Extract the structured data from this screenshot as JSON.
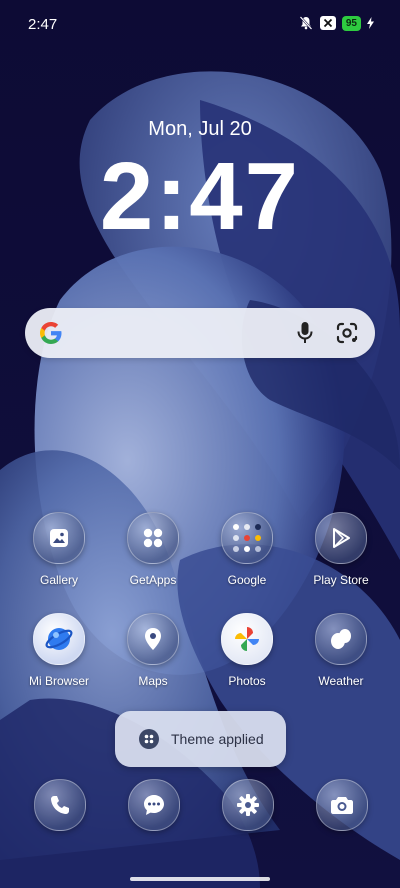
{
  "status_bar": {
    "time": "2:47",
    "battery_level": "95",
    "icons": [
      "silent-bell-icon",
      "x-notification-icon",
      "battery-icon",
      "charging-bolt-icon"
    ],
    "battery_color": "#2ecc40"
  },
  "lockscreen": {
    "date": "Mon, Jul 20",
    "clock": "2:47"
  },
  "search_bar": {
    "icons": [
      "google-logo-icon",
      "microphone-icon",
      "google-lens-icon"
    ]
  },
  "apps": [
    {
      "label": "Gallery",
      "icon": "gallery-icon"
    },
    {
      "label": "GetApps",
      "icon": "getapps-icon"
    },
    {
      "label": "Google",
      "icon": "google-folder-icon"
    },
    {
      "label": "Play Store",
      "icon": "play-store-icon"
    },
    {
      "label": "Mi Browser",
      "icon": "mi-browser-icon"
    },
    {
      "label": "Maps",
      "icon": "maps-icon"
    },
    {
      "label": "Photos",
      "icon": "photos-icon"
    },
    {
      "label": "Weather",
      "icon": "weather-icon"
    }
  ],
  "toast": {
    "text": "Theme applied",
    "icon": "themes-icon"
  },
  "dock": [
    {
      "icon": "phone-icon"
    },
    {
      "icon": "messages-icon"
    },
    {
      "icon": "settings-icon"
    },
    {
      "icon": "camera-icon"
    }
  ],
  "colors": {
    "background": "#0f0c3a",
    "wallpaper_accent": "#6f86c4"
  }
}
